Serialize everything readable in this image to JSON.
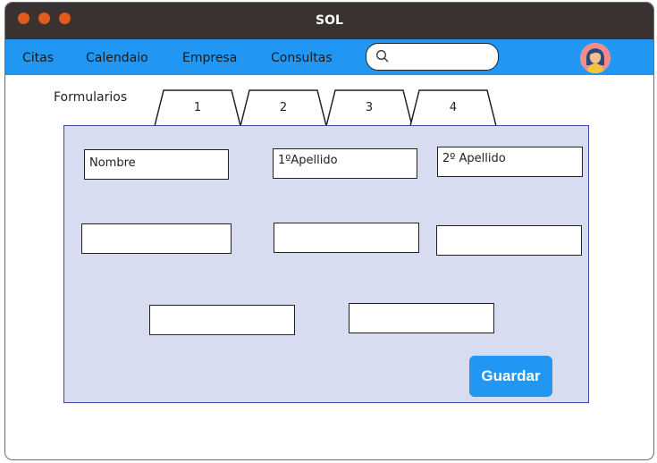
{
  "window": {
    "title": "SOL"
  },
  "nav": {
    "items": [
      "Citas",
      "Calendaio",
      "Empresa",
      "Consultas"
    ],
    "search_placeholder": ""
  },
  "section": {
    "label": "Formularios"
  },
  "tabs": [
    "1",
    "2",
    "3",
    "4"
  ],
  "form": {
    "fields": [
      "Nombre",
      "1ºApellido",
      "2º Apellido",
      "",
      "",
      "",
      "",
      ""
    ],
    "submit_label": "Guardar"
  },
  "colors": {
    "accent": "#2196f3",
    "titlebar": "#3a3131",
    "panel": "#d8dcf0",
    "window_dots": "#e25a1c"
  }
}
